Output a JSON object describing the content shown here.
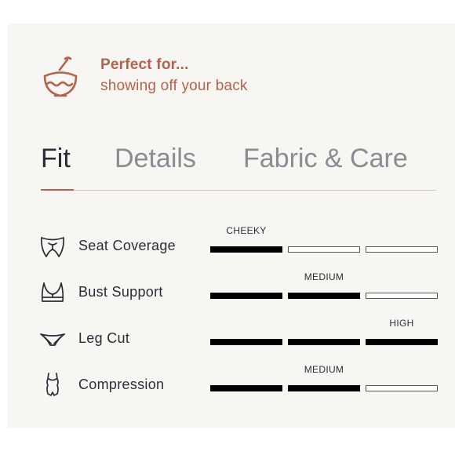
{
  "perfect_for": {
    "title": "Perfect for...",
    "subtitle": "showing off your back",
    "icon": "coconut-drink-icon"
  },
  "tabs": [
    {
      "label": "Fit",
      "active": true
    },
    {
      "label": "Details",
      "active": false
    },
    {
      "label": "Fabric & Care",
      "active": false
    }
  ],
  "fit_rows": [
    {
      "label": "Seat Coverage",
      "icon": "bikini-bottom-coverage-icon",
      "value_label": "CHEEKY",
      "level": 1,
      "max_level": 3
    },
    {
      "label": "Bust Support",
      "icon": "bra-top-icon",
      "value_label": "MEDIUM",
      "level": 2,
      "max_level": 3
    },
    {
      "label": "Leg Cut",
      "icon": "bikini-bottom-icon",
      "value_label": "HIGH",
      "level": 3,
      "max_level": 3
    },
    {
      "label": "Compression",
      "icon": "one-piece-swimsuit-icon",
      "value_label": "MEDIUM",
      "level": 2,
      "max_level": 3
    }
  ],
  "colors": {
    "accent": "#b5614c",
    "text_dark": "#2a2d38",
    "tab_inactive": "#8a8c93",
    "panel_bg": "#f8f6f3",
    "bar_filled": "#000000"
  }
}
